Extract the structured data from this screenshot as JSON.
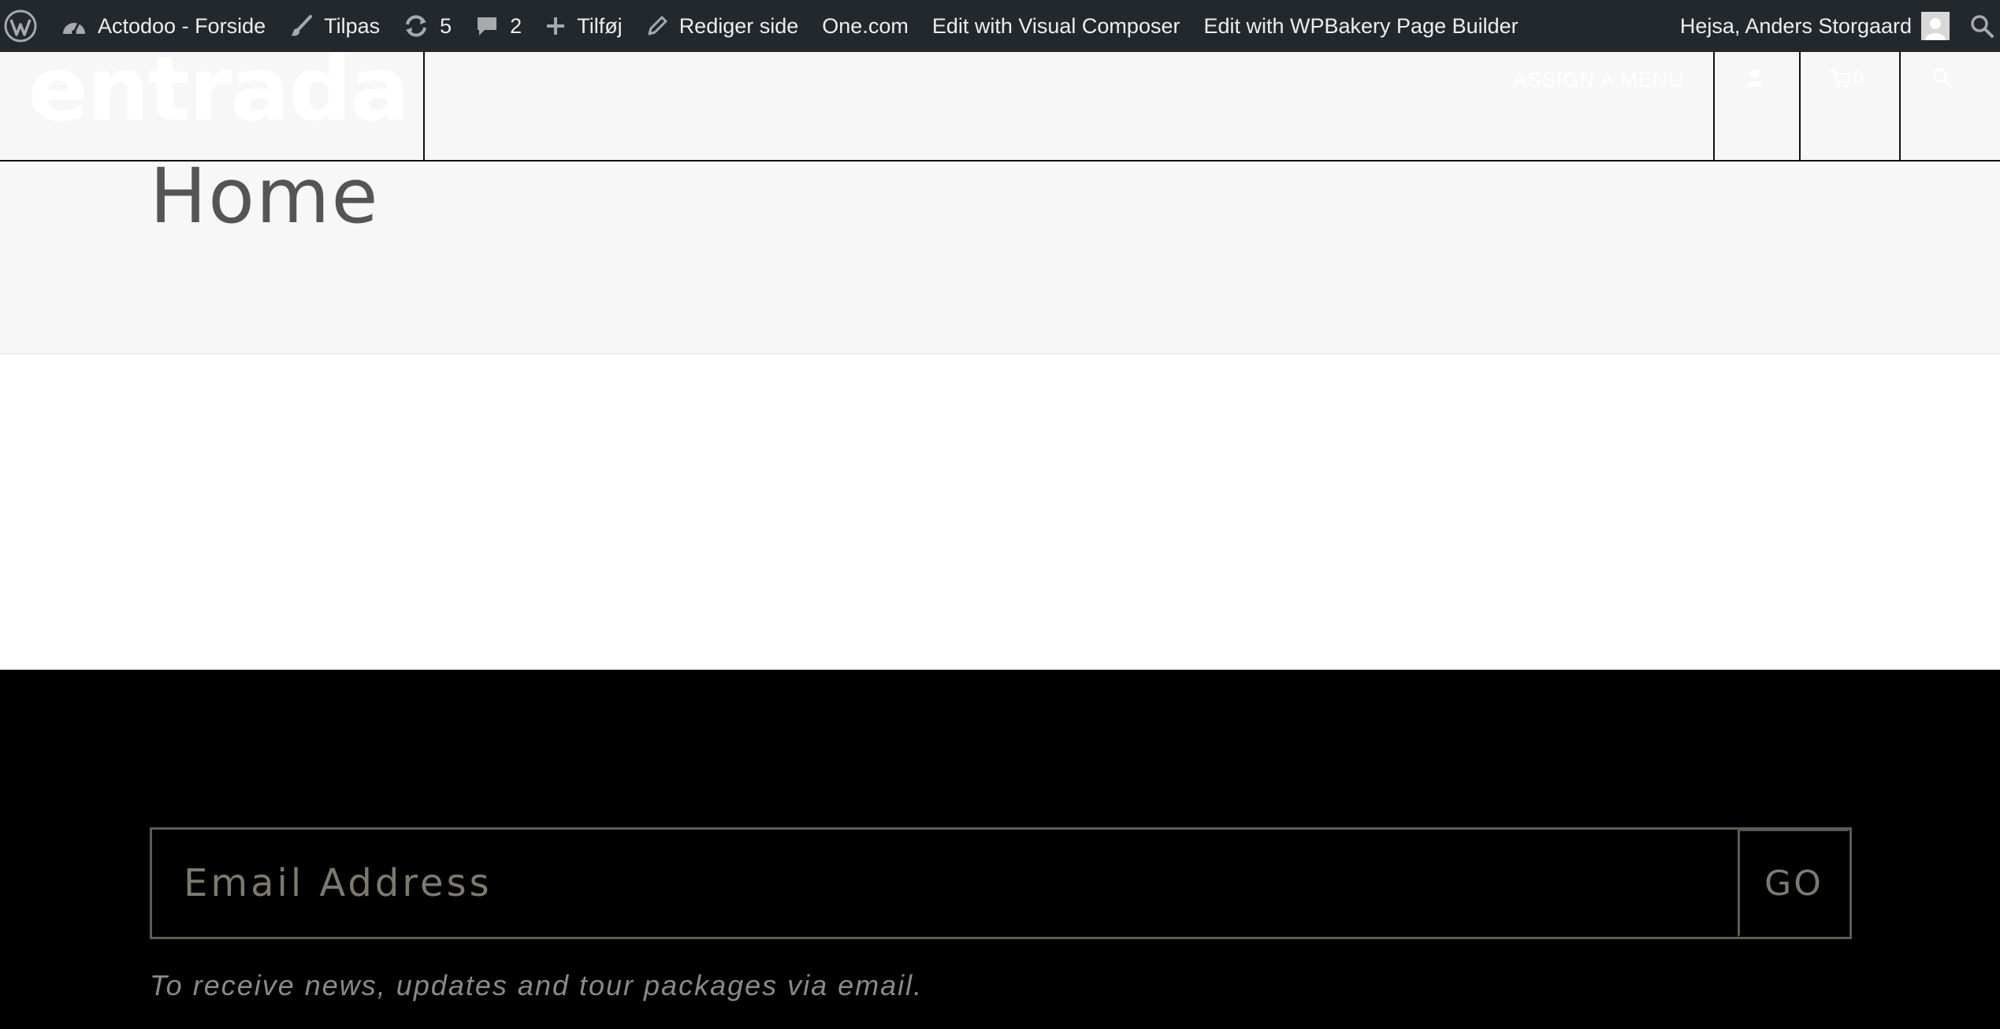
{
  "adminbar": {
    "site_name": "Actodoo - Forside",
    "customize": "Tilpas",
    "updates_count": "5",
    "comments_count": "2",
    "new": "Tilføj",
    "edit_page": "Rediger side",
    "onecom": "One.com",
    "visual_composer": "Edit with Visual Composer",
    "wpbakery": "Edit with WPBakery Page Builder",
    "greeting": "Hejsa, Anders Storgaard"
  },
  "header": {
    "logo_text": "entrada",
    "menu_link": "ASSIGN A MENU",
    "cart_count": "0"
  },
  "page": {
    "title": "Home"
  },
  "footer": {
    "email_placeholder": "Email Address",
    "go_label": "GO",
    "note": "To receive news, updates and tour packages via email."
  },
  "colors": {
    "adminbar_bg": "#23282d",
    "header_bg": "#f7f7f7",
    "footer_bg": "#000000",
    "newsletter_border": "#5f5c4f"
  }
}
